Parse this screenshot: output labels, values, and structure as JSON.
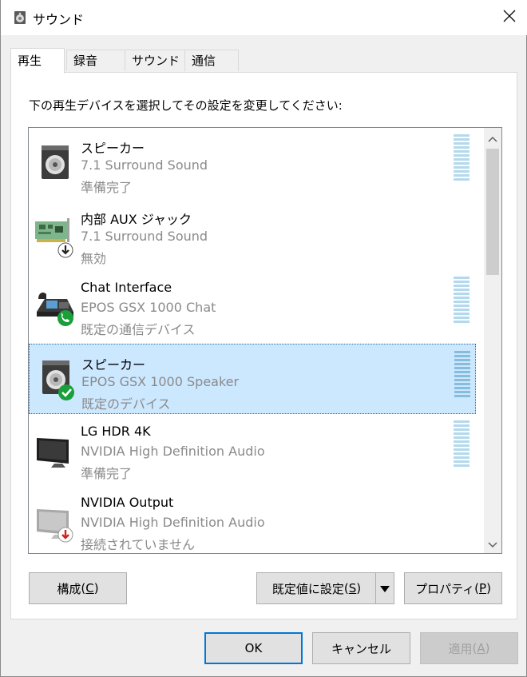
{
  "window": {
    "title": "サウンド"
  },
  "tabs": [
    {
      "label": "再生",
      "active": true
    },
    {
      "label": "録音",
      "active": false
    },
    {
      "label": "サウンド",
      "active": false
    },
    {
      "label": "通信",
      "active": false
    }
  ],
  "instruction": "下の再生デバイスを選択してその設定を変更してください:",
  "devices": [
    {
      "name": "スピーカー",
      "description": "7.1 Surround Sound",
      "status": "準備完了",
      "icon": "speaker-icon",
      "badge": "",
      "selected": false,
      "meter": true
    },
    {
      "name": "内部 AUX ジャック",
      "description": "7.1 Surround Sound",
      "status": "無効",
      "icon": "sound-card-icon",
      "badge": "disabled-arrow-icon",
      "selected": false,
      "meter": false
    },
    {
      "name": "Chat Interface",
      "description": "EPOS GSX 1000 Chat",
      "status": "既定の通信デバイス",
      "icon": "telephone-icon",
      "badge": "phone-badge-icon",
      "selected": false,
      "meter": true
    },
    {
      "name": "スピーカー",
      "description": "EPOS GSX 1000 Speaker",
      "status": "既定のデバイス",
      "icon": "speaker-icon",
      "badge": "default-check-icon",
      "selected": true,
      "meter": true
    },
    {
      "name": "LG HDR 4K",
      "description": "NVIDIA High Definition Audio",
      "status": "準備完了",
      "icon": "monitor-icon",
      "badge": "",
      "selected": false,
      "meter": true
    },
    {
      "name": "NVIDIA Output",
      "description": "NVIDIA High Definition Audio",
      "status": "接続されていません",
      "icon": "monitor-icon",
      "badge": "unplugged-arrow-icon",
      "selected": false,
      "meter": false
    }
  ],
  "buttons": {
    "configure": {
      "text": "構成",
      "key": "C"
    },
    "set_default": {
      "text": "既定値に設定",
      "key": "S"
    },
    "properties": {
      "text": "プロパティ",
      "key": "P"
    },
    "ok": "OK",
    "cancel": "キャンセル",
    "apply": {
      "text": "適用",
      "key": "A"
    }
  },
  "colors": {
    "selection": "#cce8ff",
    "accent": "#0078d7",
    "default_check": "#1a9f3a",
    "unplugged_arrow": "#d42020"
  }
}
